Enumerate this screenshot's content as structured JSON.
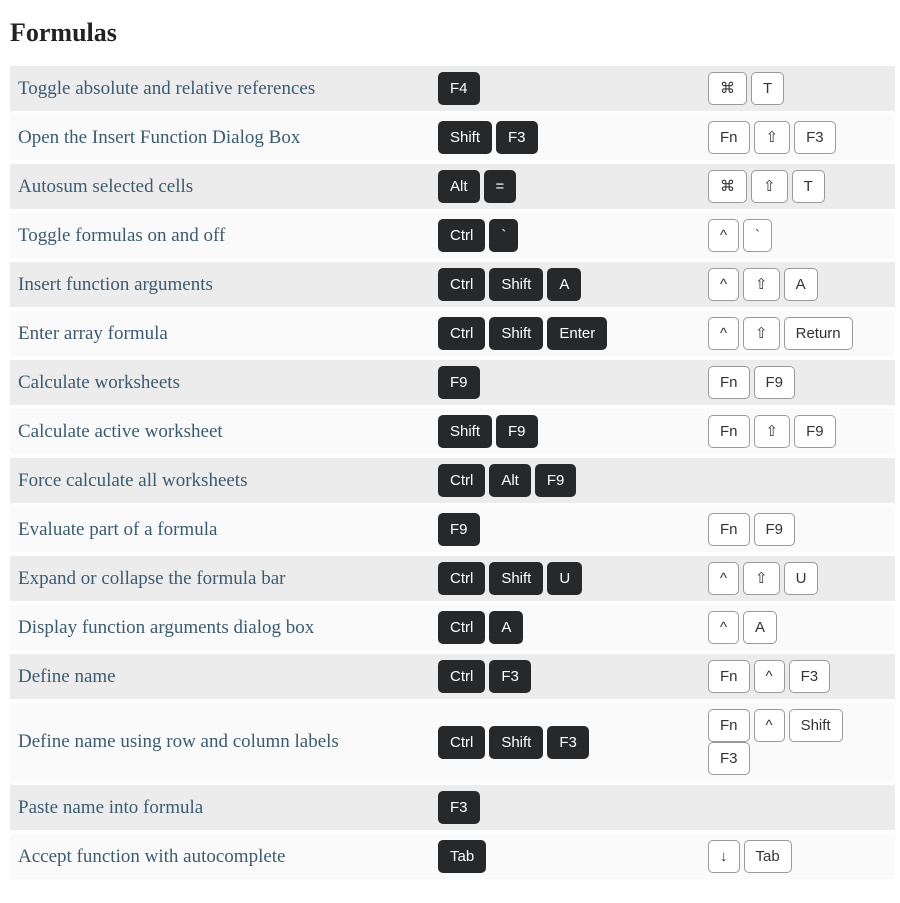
{
  "section_title": "Formulas",
  "rows": [
    {
      "desc": "Toggle absolute and relative references",
      "win": [
        "F4"
      ],
      "mac": [
        "⌘",
        "T"
      ]
    },
    {
      "desc": "Open the Insert Function Dialog Box",
      "win": [
        "Shift",
        "F3"
      ],
      "mac": [
        "Fn",
        "⇧",
        "F3"
      ]
    },
    {
      "desc": "Autosum selected cells",
      "win": [
        "Alt",
        "="
      ],
      "mac": [
        "⌘",
        "⇧",
        "T"
      ]
    },
    {
      "desc": "Toggle formulas on and off",
      "win": [
        "Ctrl",
        "`"
      ],
      "mac": [
        "^",
        "`"
      ]
    },
    {
      "desc": "Insert function arguments",
      "win": [
        "Ctrl",
        "Shift",
        "A"
      ],
      "mac": [
        "^",
        "⇧",
        "A"
      ]
    },
    {
      "desc": "Enter array formula",
      "win": [
        "Ctrl",
        "Shift",
        "Enter"
      ],
      "mac": [
        "^",
        "⇧",
        "Return"
      ]
    },
    {
      "desc": "Calculate worksheets",
      "win": [
        "F9"
      ],
      "mac": [
        "Fn",
        "F9"
      ]
    },
    {
      "desc": "Calculate active worksheet",
      "win": [
        "Shift",
        "F9"
      ],
      "mac": [
        "Fn",
        "⇧",
        "F9"
      ]
    },
    {
      "desc": "Force calculate all worksheets",
      "win": [
        "Ctrl",
        "Alt",
        "F9"
      ],
      "mac": []
    },
    {
      "desc": "Evaluate part of a formula",
      "win": [
        "F9"
      ],
      "mac": [
        "Fn",
        "F9"
      ]
    },
    {
      "desc": "Expand or collapse the formula bar",
      "win": [
        "Ctrl",
        "Shift",
        "U"
      ],
      "mac": [
        "^",
        "⇧",
        "U"
      ]
    },
    {
      "desc": "Display function arguments dialog box",
      "win": [
        "Ctrl",
        "A"
      ],
      "mac": [
        "^",
        "A"
      ]
    },
    {
      "desc": "Define name",
      "win": [
        "Ctrl",
        "F3"
      ],
      "mac": [
        "Fn",
        "^",
        "F3"
      ]
    },
    {
      "desc": "Define name using row and column labels",
      "win": [
        "Ctrl",
        "Shift",
        "F3"
      ],
      "mac": [
        "Fn",
        "^",
        "Shift",
        "F3"
      ]
    },
    {
      "desc": "Paste name into formula",
      "win": [
        "F3"
      ],
      "mac": []
    },
    {
      "desc": "Accept function with autocomplete",
      "win": [
        "Tab"
      ],
      "mac": [
        "↓",
        "Tab"
      ]
    }
  ]
}
